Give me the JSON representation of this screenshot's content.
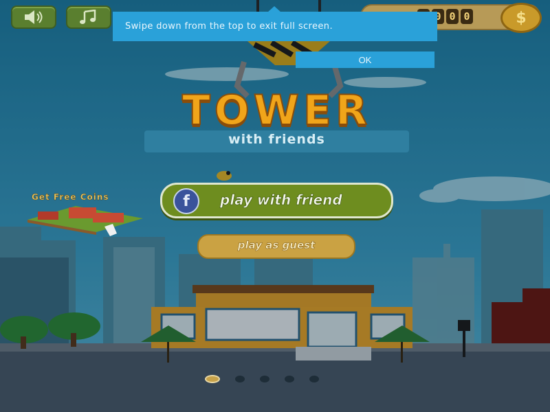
{
  "top_bar": {
    "sound_icon": "speaker-icon",
    "music_icon": "music-note-icon",
    "coins_digits": [
      "1",
      "0",
      "0",
      "0"
    ],
    "coin_icon_symbol": "$"
  },
  "toast": {
    "message": "Swipe down from the top to exit full screen.",
    "ok_label": "OK"
  },
  "logo": {
    "title": "TOWER",
    "subtitle": "with friends"
  },
  "menu": {
    "facebook_glyph": "f",
    "play_with_friend_label": "play with friend",
    "play_as_guest_label": "play as guest",
    "free_coins_label": "Get Free Coins"
  },
  "pager": {
    "count": 5,
    "active_index": 0
  },
  "colors": {
    "toast_bg": "#2aa1d9",
    "sky_top": "#1f7fa6",
    "sky_bottom": "#4bb1d6",
    "facebook_blue": "#3a539b",
    "green_button": "#6e8d1f",
    "gold_button": "#caa243"
  }
}
